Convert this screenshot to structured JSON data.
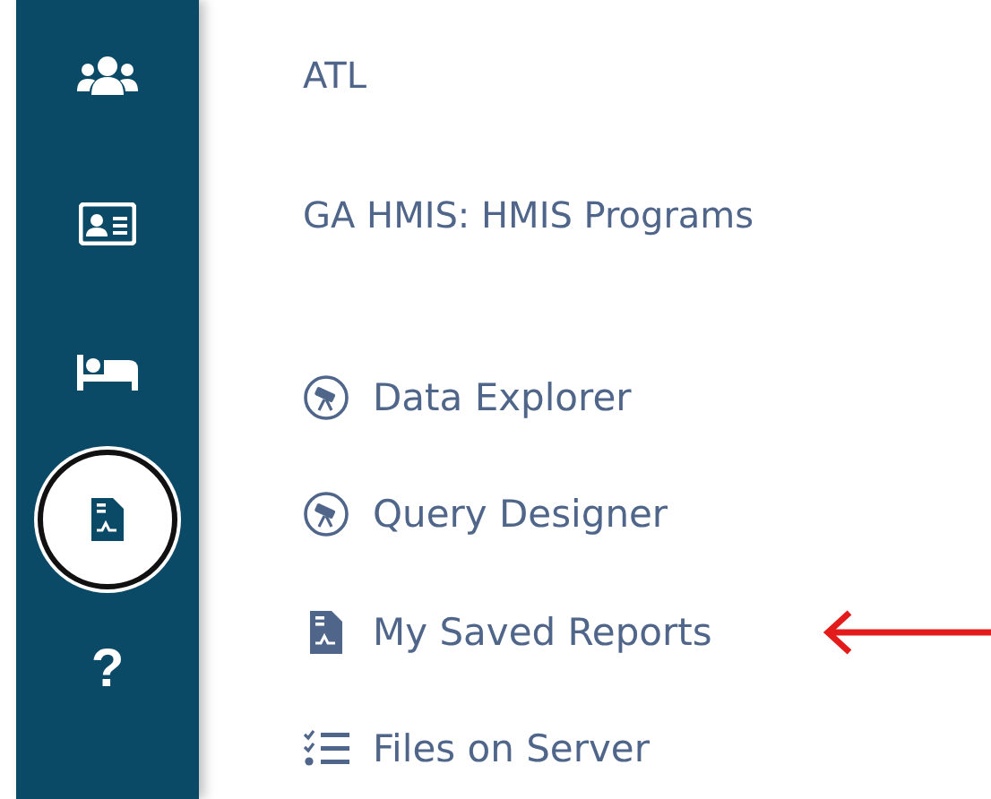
{
  "sidebar": {
    "items": [
      {
        "kind": "people",
        "selected": false
      },
      {
        "kind": "id-card",
        "selected": false
      },
      {
        "kind": "bed",
        "selected": false
      },
      {
        "kind": "report",
        "selected": true
      },
      {
        "kind": "help",
        "glyph": "?",
        "selected": false
      }
    ]
  },
  "headers": [
    "ATL",
    "GA HMIS: HMIS Programs"
  ],
  "menu": [
    {
      "label": "Data Explorer",
      "kind": "telescope"
    },
    {
      "label": "Query Designer",
      "kind": "telescope"
    },
    {
      "label": "My Saved Reports",
      "kind": "report",
      "pointed": true
    },
    {
      "label": "Files on Server",
      "kind": "checklist"
    }
  ]
}
